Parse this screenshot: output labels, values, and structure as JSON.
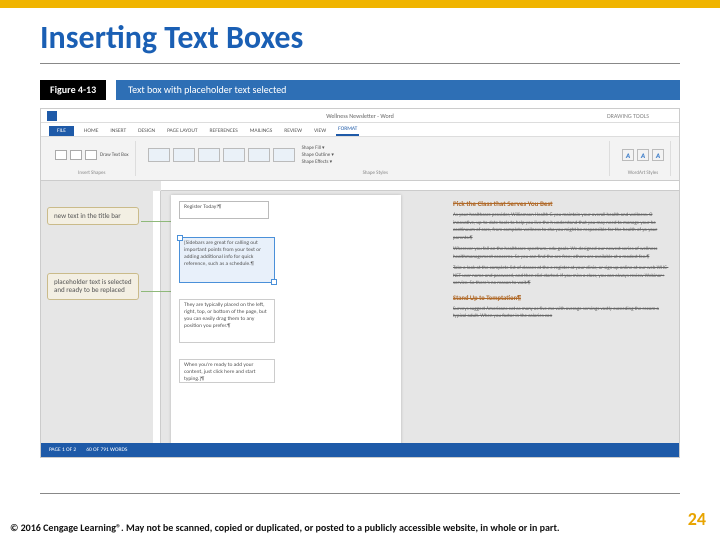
{
  "slide": {
    "title": "Inserting Text Boxes",
    "page_number": "24",
    "footer": "© 2016 Cengage Learning®. May not be scanned, copied or duplicated, or posted to a publicly accessible website, in whole or in part."
  },
  "figure": {
    "number": "Figure 4-13",
    "title": "Text box with placeholder text selected"
  },
  "word": {
    "title": "Wellness Newsletter - Word",
    "drawing_tools": "DRAWING TOOLS",
    "tabs": {
      "file": "FILE",
      "home": "HOME",
      "insert": "INSERT",
      "design": "DESIGN",
      "page_layout": "PAGE LAYOUT",
      "references": "REFERENCES",
      "mailings": "MAILINGS",
      "review": "REVIEW",
      "view": "VIEW",
      "format": "FORMAT"
    },
    "ribbon": {
      "draw_text_box": "Draw Text Box",
      "insert_shapes": "Insert Shapes",
      "shape_styles": "Shape Styles",
      "wordart_styles": "WordArt Styles",
      "shape_fill": "Shape Fill ▾",
      "shape_outline": "Shape Outline ▾",
      "shape_effects": "Shape Effects ▾"
    },
    "status": {
      "page": "PAGE 1 OF 2",
      "words": "60 OF 791 WORDS"
    }
  },
  "callouts": {
    "c1": "new text in the title bar",
    "c2": "placeholder text is selected and ready to be replaced"
  },
  "textboxes": {
    "title": "Register Today!¶",
    "sel": "[Sidebars are great for calling out important points from your text or adding additional info for quick reference, such as a schedule.¶",
    "mid": "They are typically placed on the left, right, top, or bottom of the page, but you can easily drag them to any position you prefer.¶",
    "low": "When you're ready to add your content, just click here and start typing.]¶"
  },
  "body": {
    "heading": "Pick the Class that Serves You Best",
    "p1": "As your healthcare provider, Williamson Health G you maintain your overall health and wellness. O innovative, up-to-date tools to help you live the h understand that you may need to manage your he continuum of care, from complete wellness to cha you might be responsible for the health of yo your parents.¶",
    "p2": "Wherever you fall on the healthcare spectrum, edu goals. We designed our newest series of wellness healthmanagement concerns. So you can find the are free; others are available at a modest fee.¶",
    "p3": "Take a look at the complete list of classes at the e register at your clinic, or sign up online at our web WHC-NET user name and password, and then clicl started. If you miss a class, you can always review Webinar+ service. So there's no reason to wait.¶",
    "sub": "Stand Up to Temptation¶",
    "p4": "Surveys suggest Americans eat as many as five me with average servings vastly exceeding the recom a typical adult. When you factor in the calories con"
  }
}
